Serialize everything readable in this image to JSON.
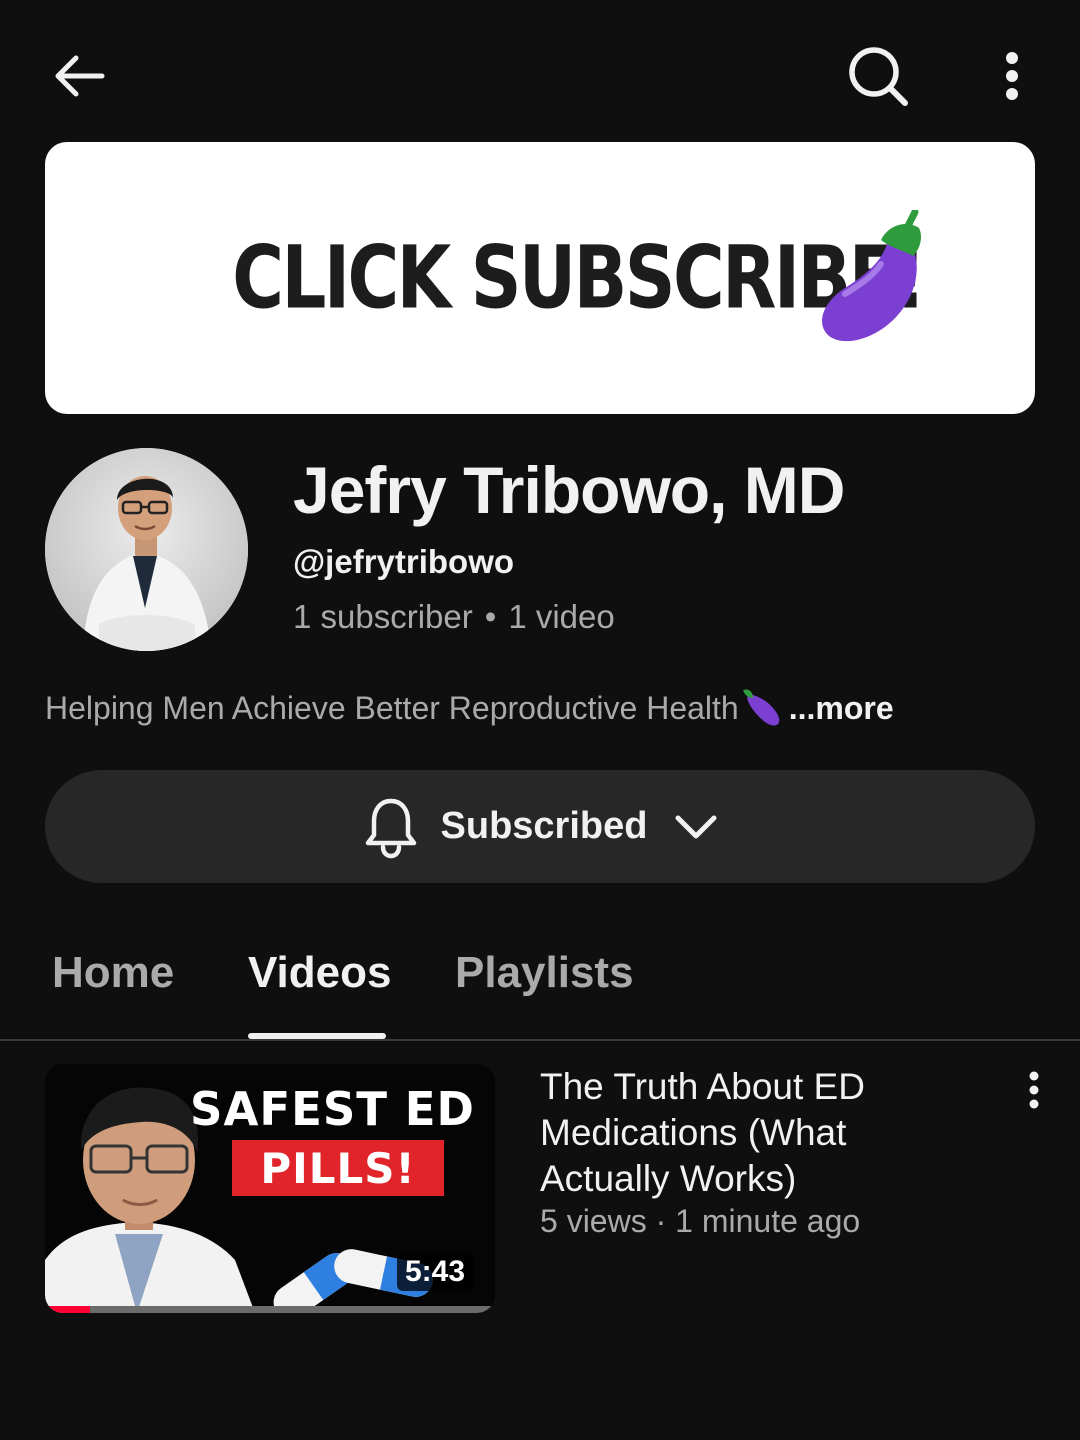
{
  "top_bar": {
    "back_icon": "arrow-left-icon",
    "search_icon": "search-icon",
    "more_icon": "more-vertical-icon"
  },
  "banner": {
    "text": "CLICK SUBSCRIBE!",
    "emoji": "eggplant-icon"
  },
  "channel": {
    "name": "Jefry Tribowo, MD",
    "handle": "@jefrytribowo",
    "subscribers": "1 subscriber",
    "separator": "•",
    "videos": "1 video",
    "description": "Helping Men Achieve Better Reproductive Health",
    "more_label": "...more"
  },
  "subscribe_button": {
    "label": "Subscribed",
    "bell_icon": "bell-icon",
    "chevron_icon": "chevron-down-icon"
  },
  "tabs": [
    {
      "label": "Home",
      "active": false
    },
    {
      "label": "Videos",
      "active": true
    },
    {
      "label": "Playlists",
      "active": false
    }
  ],
  "videos": [
    {
      "thumbnail_headline": "SAFEST ED",
      "thumbnail_badge": "PILLS!",
      "duration": "5:43",
      "watch_progress": 0.1,
      "title": "The Truth About ED Medications (What Actually Works)",
      "meta": "5 views · 1 minute ago"
    }
  ],
  "colors": {
    "background": "#0f0f0f",
    "surface": "#272727",
    "text_primary": "#f1f1f1",
    "text_secondary": "#aaaaaa",
    "progress": "#ff0033",
    "badge_red": "#e0242a",
    "eggplant": "#7b3fd1"
  }
}
